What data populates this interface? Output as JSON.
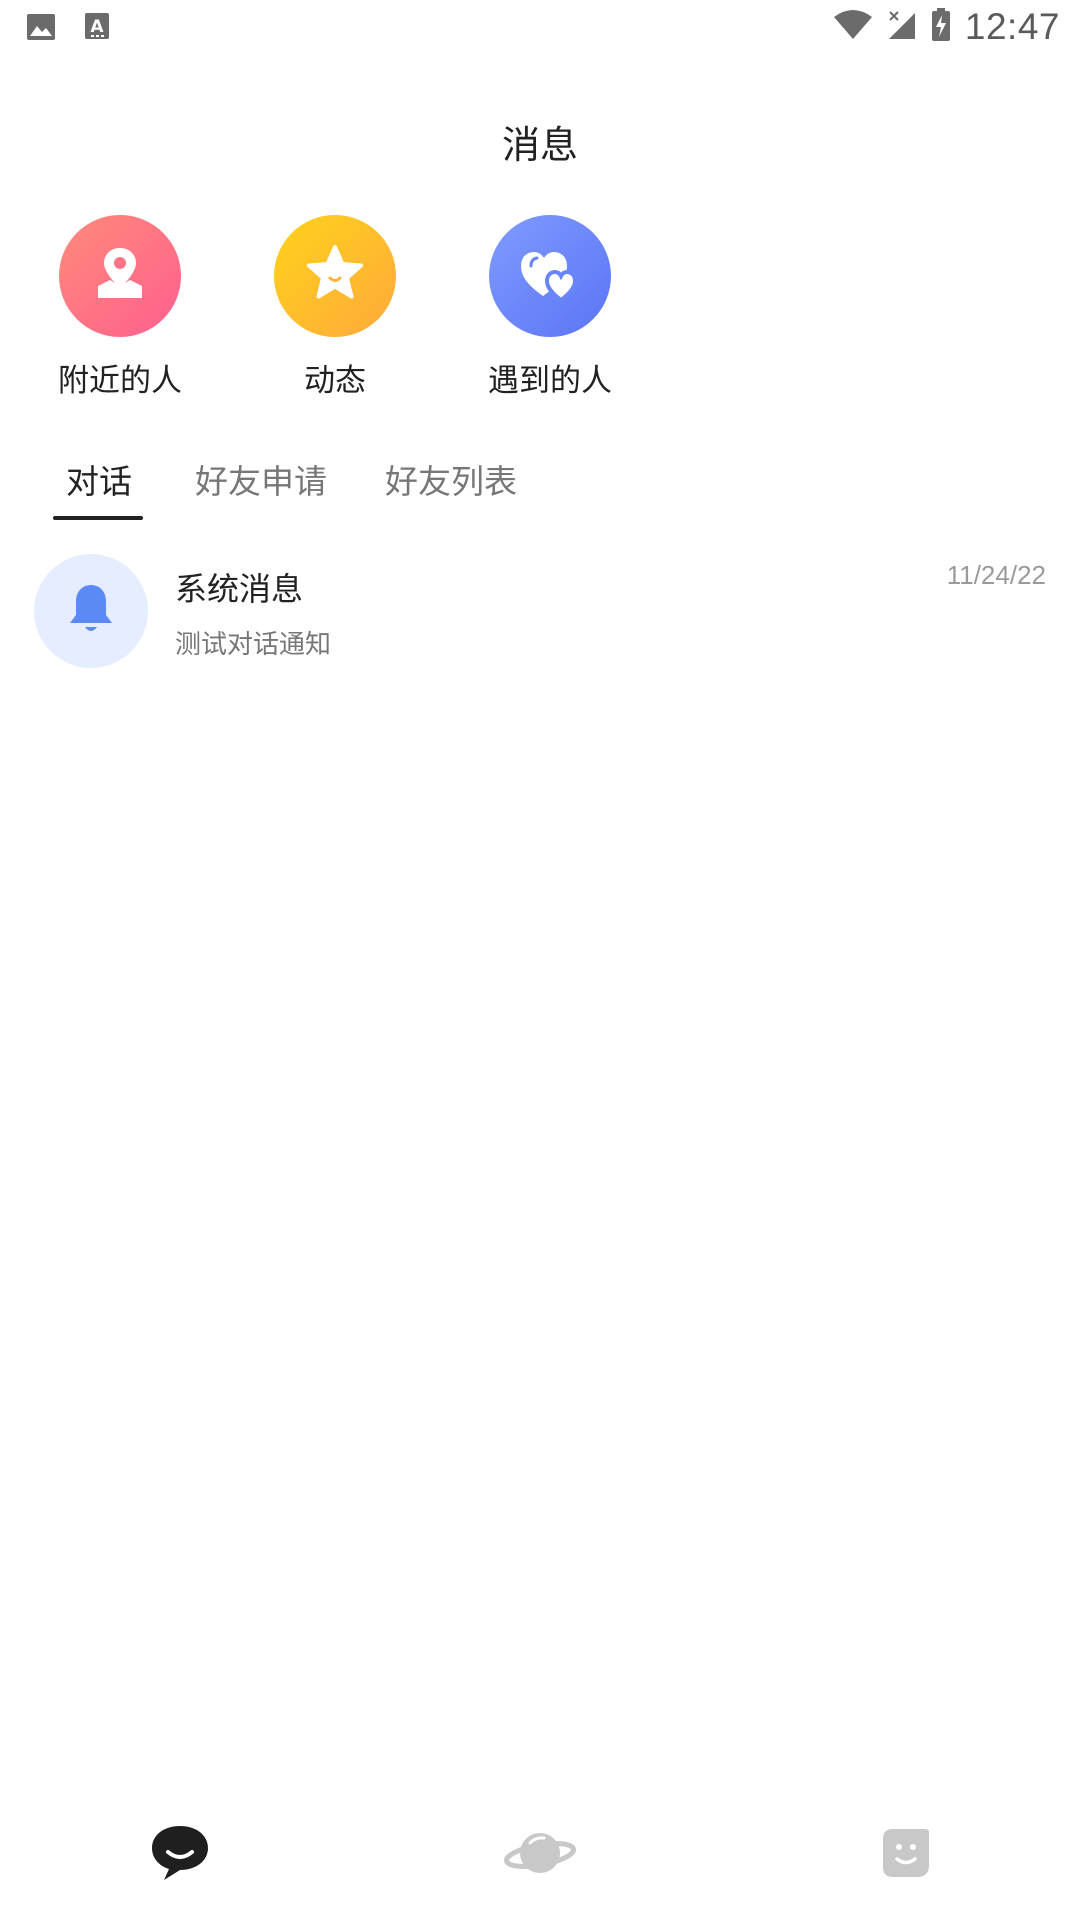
{
  "status_bar": {
    "time": "12:47",
    "left_icons": [
      "image-icon",
      "keyboard-a-icon"
    ],
    "right_icons": [
      "wifi-icon",
      "no-signal-icon",
      "battery-charging-icon"
    ]
  },
  "header": {
    "title": "消息"
  },
  "quick_entries": [
    {
      "label": "附近的人",
      "icon": "location-map-icon",
      "color": "#ff6f88"
    },
    {
      "label": "动态",
      "icon": "star-icon",
      "color": "#ffbf2a"
    },
    {
      "label": "遇到的人",
      "icon": "hearts-icon",
      "color": "#6a84fa"
    }
  ],
  "tabs": [
    {
      "label": "对话",
      "active": true
    },
    {
      "label": "好友申请",
      "active": false
    },
    {
      "label": "好友列表",
      "active": false
    }
  ],
  "conversations": [
    {
      "title": "系统消息",
      "preview": "测试对话通知",
      "time": "11/24/22",
      "icon": "bell-icon",
      "icon_color": "#5b8af5"
    }
  ],
  "bottom_nav": [
    {
      "icon": "chat-bubble-icon",
      "active": true
    },
    {
      "icon": "planet-icon",
      "active": false
    },
    {
      "icon": "smiley-face-icon",
      "active": false
    }
  ]
}
